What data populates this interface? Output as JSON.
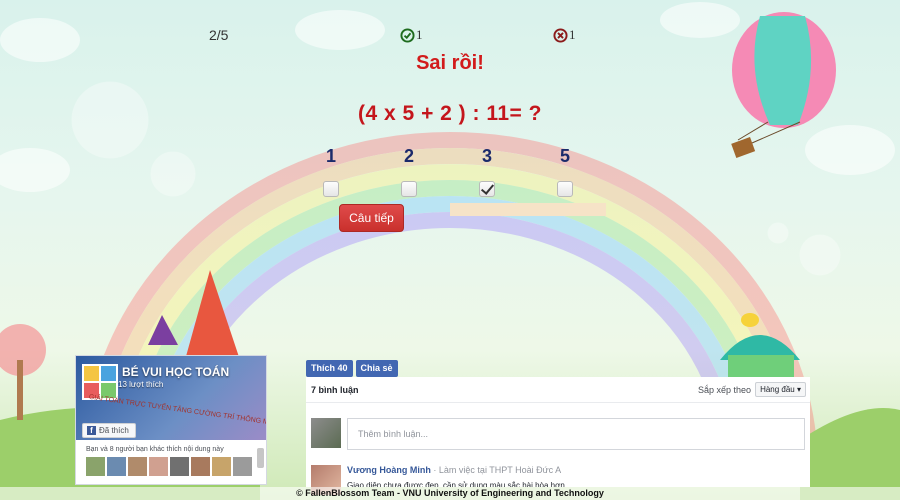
{
  "counters": {
    "progress": "2/5",
    "correct": "1",
    "wrong": "1",
    "correct_icon": "check-circle-icon",
    "wrong_icon": "x-circle-icon"
  },
  "quiz": {
    "result": "Sai rồi!",
    "question": "(4 x 5 + 2 ) : 11= ?",
    "answers": [
      {
        "value": "1",
        "checked": false
      },
      {
        "value": "2",
        "checked": false
      },
      {
        "value": "3",
        "checked": true
      },
      {
        "value": "5",
        "checked": false
      }
    ],
    "next_label": "Câu tiếp"
  },
  "fb_page": {
    "name": "BÉ VUI HỌC TOÁN",
    "likes": "13 lượt thích",
    "cover_text": "GIẢI TOÁN TRỰC TUYẾN TĂNG CƯỜNG TRÍ THÔNG MINH",
    "liked_label": "Đã thích",
    "friends_text": "Bạn và 8 người bạn khác thích nội dung này"
  },
  "comments": {
    "like_label": "Thích 40",
    "share_label": "Chia sẻ",
    "count_label": "7 bình luận",
    "sort_label": "Sắp xếp theo",
    "sort_value": "Hàng đầu ▾",
    "placeholder": "Thêm bình luận...",
    "items": [
      {
        "author": "Vương Hoàng Minh",
        "meta": "· Làm việc tại THPT Hoài Đức A",
        "text": "Giao diện chưa được đẹp, cần sử dụng màu sắc hài hòa hơn"
      }
    ]
  },
  "footer": "© FallenBlossom Team - VNU University of Engineering and Technology",
  "colors": {
    "result": "#d21b1b",
    "question": "#c4161c",
    "answers": "#1b2a6b",
    "next_button": "#d9534f",
    "facebook": "#4267b2"
  }
}
